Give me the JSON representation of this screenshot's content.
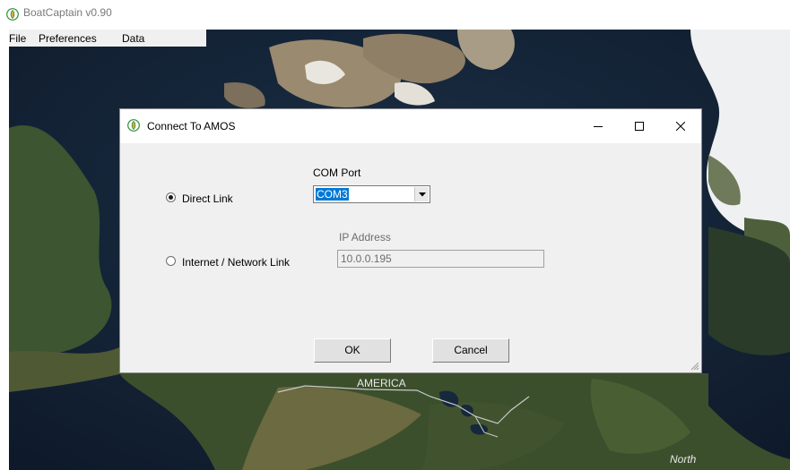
{
  "app": {
    "title": "BoatCaptain v0.90",
    "menu": [
      "File",
      "Preferences",
      "Data"
    ]
  },
  "map": {
    "labels": [
      "AMERICA",
      "North"
    ]
  },
  "dialog": {
    "title": "Connect To AMOS",
    "options": {
      "direct": {
        "label": "Direct Link",
        "selected": true
      },
      "network": {
        "label": "Internet / Network Link",
        "selected": false
      }
    },
    "com_port": {
      "label": "COM Port",
      "value": "COM3"
    },
    "ip_address": {
      "label": "IP Address",
      "value": "10.0.0.195"
    },
    "buttons": {
      "ok": "OK",
      "cancel": "Cancel"
    }
  },
  "colors": {
    "selection": "#0078d7",
    "dialog_bg": "#f0f0f0",
    "ocean": "#152436"
  },
  "icons": [
    "app-logo-icon",
    "minimize-icon",
    "maximize-icon",
    "close-icon",
    "chevron-down-icon",
    "resize-grip-icon"
  ]
}
